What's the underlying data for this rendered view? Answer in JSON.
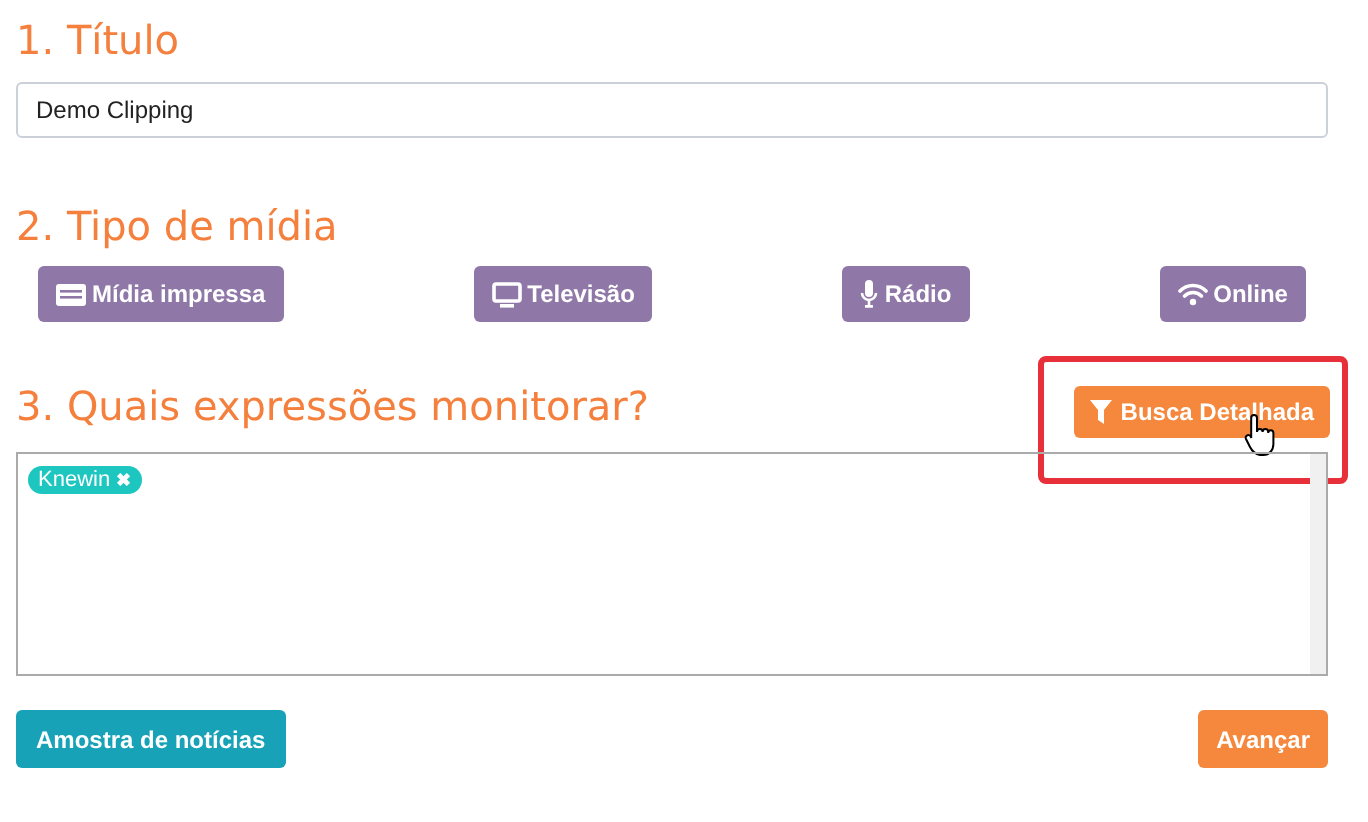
{
  "sections": [
    {
      "heading": "1. Título"
    },
    {
      "heading": "2. Tipo de mídia"
    },
    {
      "heading": "3. Quais expressões monitorar?"
    }
  ],
  "title_field": {
    "value": "Demo Clipping"
  },
  "media_types": [
    {
      "kind": "print",
      "label": "Mídia impressa"
    },
    {
      "kind": "tv",
      "label": "Televisão"
    },
    {
      "kind": "radio",
      "label": "Rádio"
    },
    {
      "kind": "online",
      "label": "Online"
    }
  ],
  "detail_search_button": {
    "label": "Busca Detalhada",
    "highlighted": true
  },
  "expressions": [
    {
      "label": "Knewin",
      "remove": "✖"
    }
  ],
  "buttons": {
    "sample": "Amostra de notícias",
    "next": "Avançar"
  }
}
